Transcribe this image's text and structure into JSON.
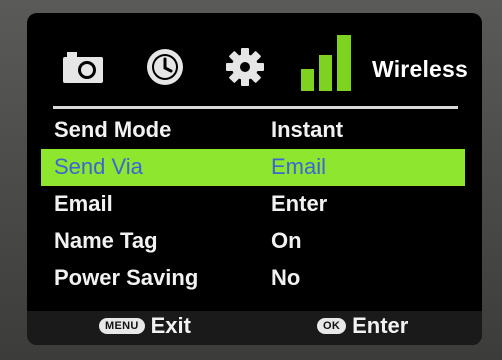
{
  "tabs": {
    "icons": [
      "camera-icon",
      "clock-icon",
      "gear-icon",
      "signal-icon"
    ],
    "wireless_label": "Wireless"
  },
  "menu": {
    "rows": [
      {
        "label": "Send Mode",
        "value": "Instant"
      },
      {
        "label": "Send Via",
        "value": "Email"
      },
      {
        "label": "Email",
        "value": "Enter"
      },
      {
        "label": "Name Tag",
        "value": "On"
      },
      {
        "label": "Power Saving",
        "value": "No"
      }
    ],
    "selected_index": 1
  },
  "footer": {
    "menu_key": "MENU",
    "menu_action": "Exit",
    "ok_key": "OK",
    "ok_action": "Enter"
  },
  "colors": {
    "highlight": "#8ee62f",
    "selected_text": "#3a66d6",
    "signal_bars": "#7ed321"
  }
}
